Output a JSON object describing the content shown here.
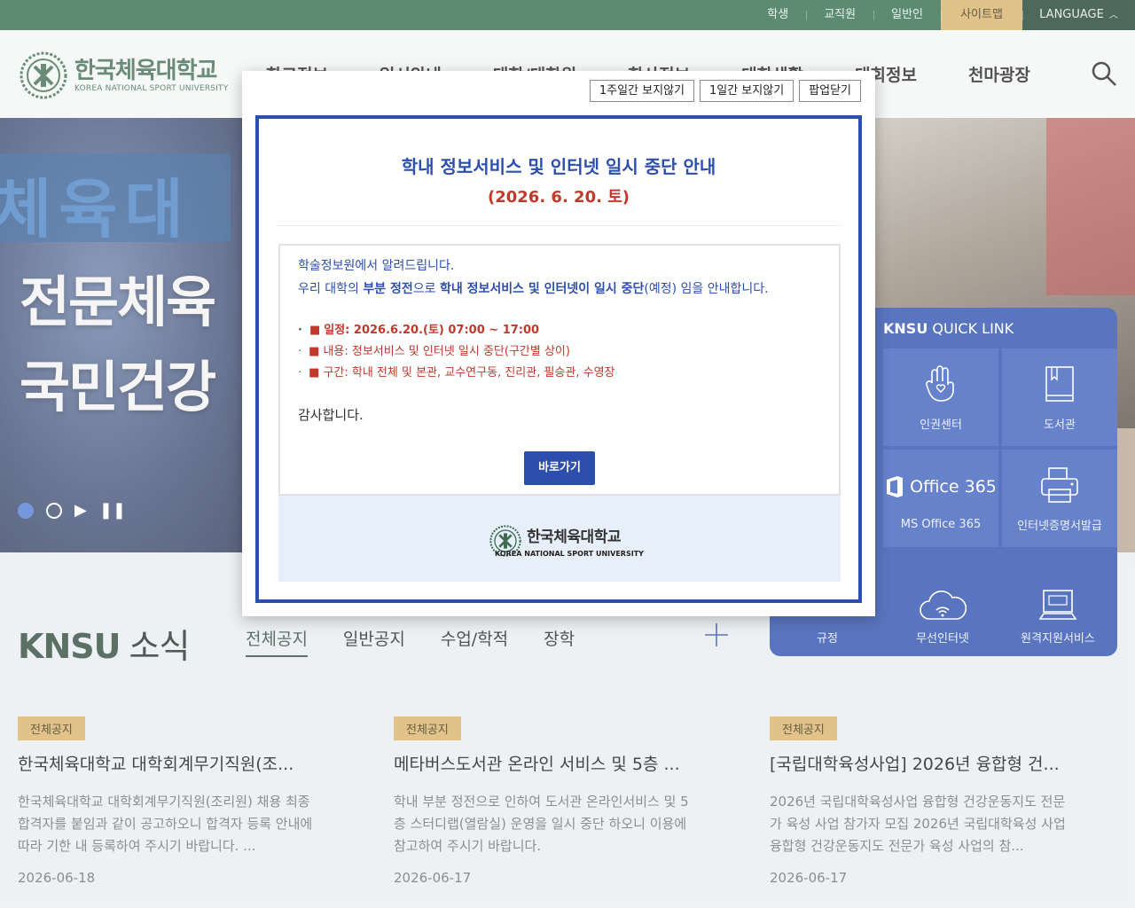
{
  "util_nav": {
    "items": [
      "학생",
      "교직원",
      "일반인"
    ],
    "sitemap": "사이트맵",
    "language": "LANGUAGE"
  },
  "header": {
    "logo_ko": "한국체육대학교",
    "logo_en": "KOREA NATIONAL SPORT UNIVERSITY",
    "gnb": [
      "학교정보",
      "입시안내",
      "대학/대학원",
      "학사정보",
      "대학생활",
      "대회정보",
      "천마광장"
    ]
  },
  "hero": {
    "title_line1": "전문체육",
    "title_line2": "국민건강",
    "banner_text": "체육대"
  },
  "quick_link": {
    "title_bold": "KNSU",
    "title_rest": " QUICK LINK",
    "items": [
      "인권센터",
      "도서관",
      "MS Office 365",
      "인터넷증명서발급"
    ],
    "office_logo": "Office 365",
    "bottom": [
      "규정",
      "무선인터넷",
      "원격지원서비스"
    ]
  },
  "news": {
    "title_bold": "KNSU",
    "title_rest": "소식",
    "tabs": [
      "전체공지",
      "일반공지",
      "수업/학적",
      "장학"
    ],
    "cards": [
      {
        "badge": "전체공지",
        "title": "한국체육대학교 대학회계무기직원(조...",
        "body": "한국체육대학교 대학회계무기직원(조리원) 채용 최종합격자를 붙임과 같이 공고하오니 합격자 등록 안내에 따라 기한 내 등록하여 주시기 바랍니다. ...",
        "date": "2026-06-18"
      },
      {
        "badge": "전체공지",
        "title": "메타버스도서관 온라인 서비스 및 5층 ...",
        "body": "학내 부분 정전으로 인하여 도서관 온라인서비스 및 5층 스터디랩(열람실) 운영을 일시 중단 하오니 이용에 참고하여 주시기 바랍니다.",
        "date": "2026-06-17"
      },
      {
        "badge": "전체공지",
        "title": "[국립대학육성사업] 2026년 융합형 건...",
        "body": "2026년 국립대학육성사업 융합형 건강운동지도 전문가 육성 사업 참가자 모집 2026년 국립대학육성 사업 융합형 건강운동지도 전문가 육성 사업의 참...",
        "date": "2026-06-17"
      }
    ]
  },
  "popup": {
    "btn_week": "1주일간 보지않기",
    "btn_day": "1일간 보지않기",
    "btn_close": "팝업닫기",
    "title": "학내 정보서비스 및 인터넷 일시 중단 안내",
    "date": "(2026. 6. 20. 토)",
    "line1": "학술정보원에서 알려드립니다.",
    "line2_a": "우리 대학의 ",
    "line2_b": "부분 정전",
    "line2_c": "으로 ",
    "line2_d": "학내 정보서비스 및 인터넷이 일시 중단",
    "line2_e": "(예정) 임을 안내합니다.",
    "list": [
      "일정: 2026.6.20.(토) 07:00 ~ 17:00",
      "내용: 정보서비스 및 인터넷 일시 중단(구간별 상이)",
      "구간: 학내 전체 및 본관, 교수연구동, 진리관, 필승관, 수영장"
    ],
    "thanks": "감사합니다.",
    "go_button": "바로가기",
    "footer_logo_ko": "한국체육대학교",
    "footer_logo_en": "KOREA NATIONAL SPORT UNIVERSITY"
  },
  "colors": {
    "brand_green": "#2f6b4b",
    "gold": "#d9b36a",
    "popup_blue": "#2c4fae",
    "alert_red": "#c0392b"
  }
}
